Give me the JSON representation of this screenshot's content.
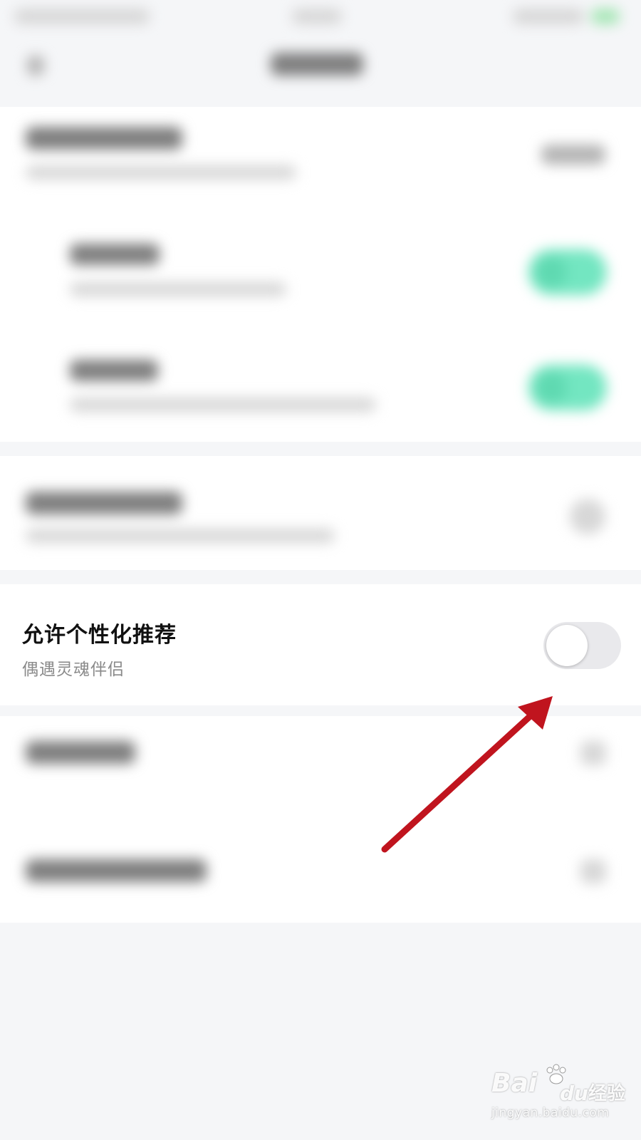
{
  "setting": {
    "title": "允许个性化推荐",
    "subtitle": "偶遇灵魂伴侣",
    "toggle_state": "off"
  },
  "watermark": {
    "logo_text": "Bai",
    "logo_tail": "du",
    "brand_cn": "经验",
    "url": "jingyan.baidu.com"
  },
  "colors": {
    "toggle_on": "#73e6c1",
    "toggle_off": "#e9e9ec",
    "arrow": "#c0141e"
  },
  "icons": {
    "back": "back-arrow-icon",
    "annotation": "red-arrow-icon"
  }
}
